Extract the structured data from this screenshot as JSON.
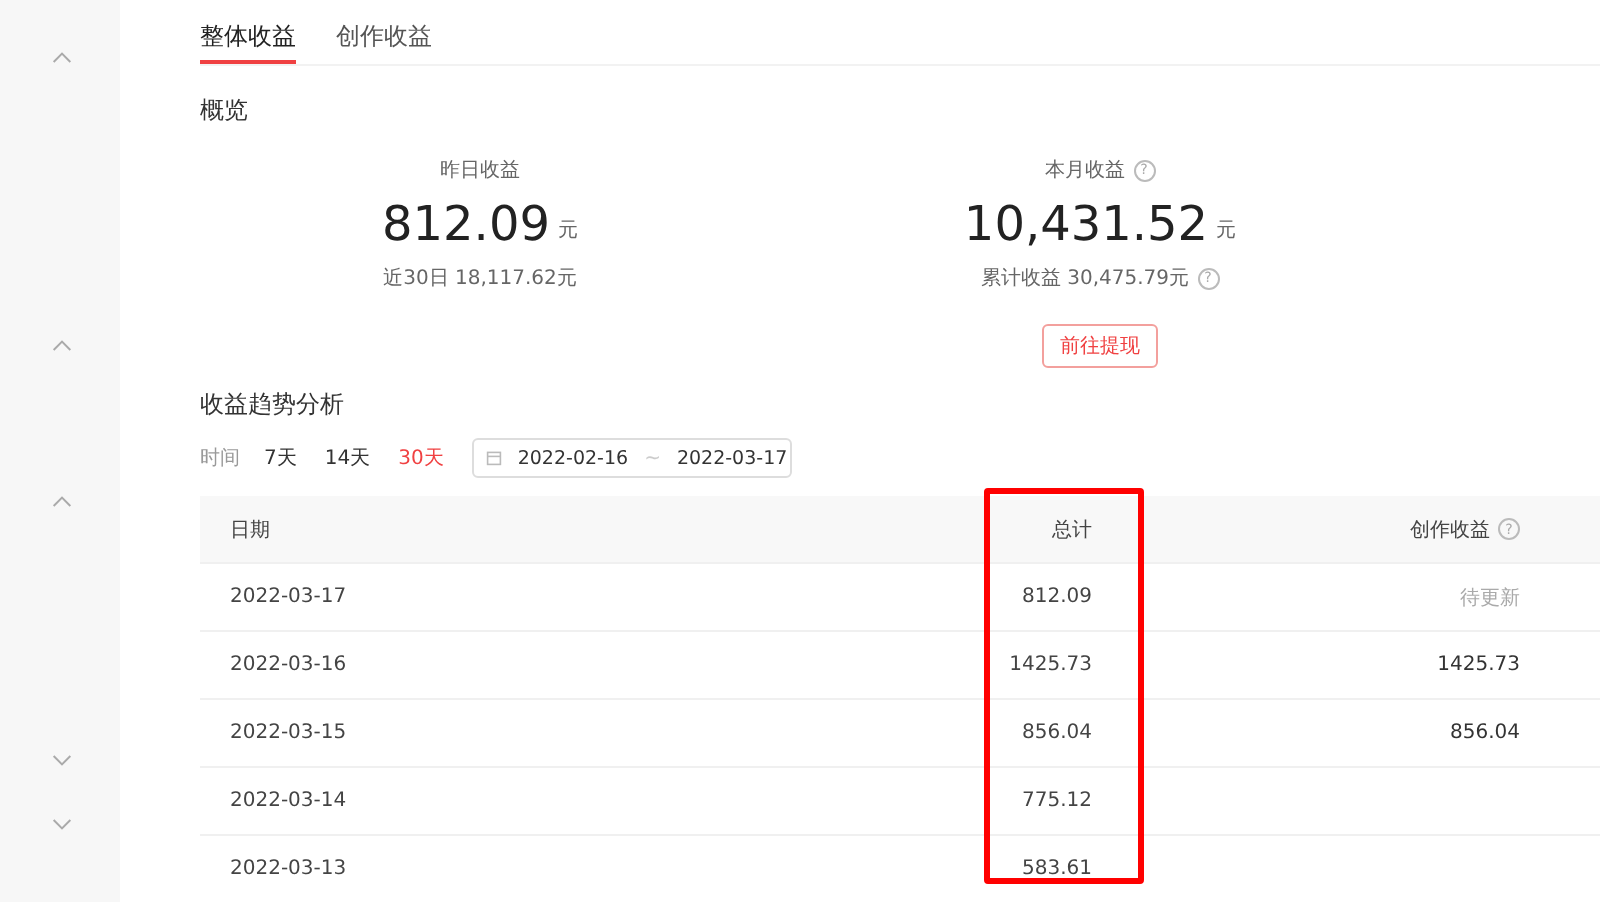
{
  "sidebar": {
    "toggles": [
      {
        "expanded": true
      },
      {
        "expanded": true
      },
      {
        "expanded": true
      },
      {
        "expanded": false
      },
      {
        "expanded": false
      }
    ]
  },
  "tabs": [
    {
      "label": "整体收益",
      "selected": true
    },
    {
      "label": "创作收益",
      "selected": false
    }
  ],
  "overview": {
    "title": "概览",
    "stats": [
      {
        "label": "昨日收益",
        "value": "812.09",
        "unit": "元",
        "sub": "近30日 18,117.62元"
      },
      {
        "label": "本月收益",
        "help": "?",
        "value": "10,431.52",
        "unit": "元",
        "sub": "累计收益 30,475.79元",
        "sub_help": "?",
        "button": "前往提现"
      }
    ]
  },
  "trend": {
    "title": "收益趋势分析",
    "time_label": "时间",
    "ranges": [
      {
        "label": "7天",
        "selected": false
      },
      {
        "label": "14天",
        "selected": false
      },
      {
        "label": "30天",
        "selected": true
      }
    ],
    "date_range": {
      "start": "2022-02-16",
      "separator": "~",
      "end": "2022-03-17"
    }
  },
  "table": {
    "columns": [
      {
        "label": "日期",
        "highlighted": false
      },
      {
        "label": "总计",
        "highlighted": true
      },
      {
        "label": "创作收益",
        "help": "?",
        "highlighted": false
      }
    ],
    "rows": [
      {
        "date": "2022-03-17",
        "total": "812.09",
        "creation": "待更新",
        "pending": true
      },
      {
        "date": "2022-03-16",
        "total": "1425.73",
        "creation": "1425.73",
        "pending": false
      },
      {
        "date": "2022-03-15",
        "total": "856.04",
        "creation": "856.04",
        "pending": false
      },
      {
        "date": "2022-03-14",
        "total": "775.12"
      },
      {
        "date": "2022-03-13",
        "total": "583.61"
      }
    ]
  }
}
